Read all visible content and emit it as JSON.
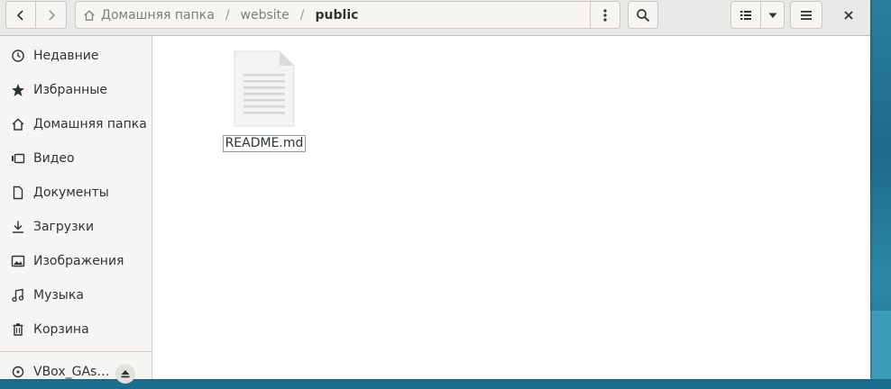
{
  "header": {
    "breadcrumbs": [
      "Домашняя папка",
      "website",
      "public"
    ],
    "separator": "/"
  },
  "sidebar": {
    "items": [
      {
        "label": "Недавние",
        "icon": "clock-icon"
      },
      {
        "label": "Избранные",
        "icon": "star-icon"
      },
      {
        "label": "Домашняя папка",
        "icon": "home-icon"
      },
      {
        "label": "Видео",
        "icon": "video-icon"
      },
      {
        "label": "Документы",
        "icon": "document-icon"
      },
      {
        "label": "Загрузки",
        "icon": "download-icon"
      },
      {
        "label": "Изображения",
        "icon": "image-icon"
      },
      {
        "label": "Музыка",
        "icon": "music-icon"
      },
      {
        "label": "Корзина",
        "icon": "trash-icon"
      }
    ],
    "devices": [
      {
        "label": "VBox_GAs…",
        "icon": "disc-icon"
      }
    ]
  },
  "files": [
    {
      "name": "README.md",
      "icon": "text-file-icon"
    }
  ],
  "colors": {
    "header_bg": "#e8e8e7",
    "sidebar_bg": "#f6f5f4",
    "text": "#2e3436",
    "desktop": "#1a6e8c"
  }
}
